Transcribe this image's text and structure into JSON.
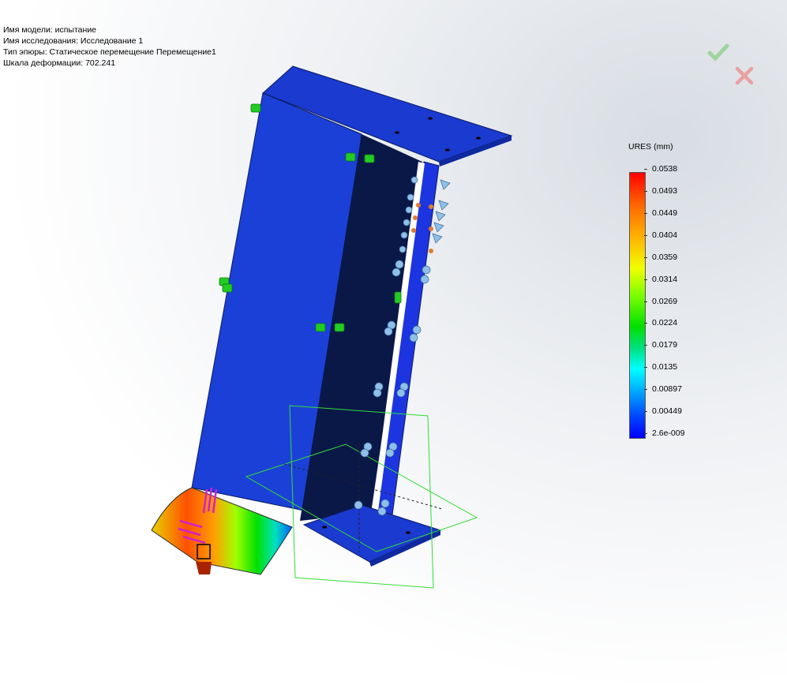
{
  "info": {
    "model_name": "Имя модели: испытание",
    "study_name": "Имя  исследования: Исследование 1",
    "plot_type": "Тип эпюры: Статическое перемещение Перемещение1",
    "deformation_scale": "Шкала деформации: 702.241"
  },
  "buttons": {
    "ok_icon": "checkmark-icon",
    "cancel_icon": "close-icon"
  },
  "legend": {
    "title": "URES (mm)",
    "ticks": [
      "0.0538",
      "0.0493",
      "0.0449",
      "0.0404",
      "0.0359",
      "0.0314",
      "0.0269",
      "0.0224",
      "0.0179",
      "0.0135",
      "0.00897",
      "0.00449",
      "2.6e-009"
    ]
  },
  "colors": {
    "part_blue": "#1a3fd6",
    "part_dark": "#0a1a4a",
    "fixture_green": "#22cc22",
    "load_magenta": "#d020d0",
    "plane_green": "#33dd33"
  }
}
